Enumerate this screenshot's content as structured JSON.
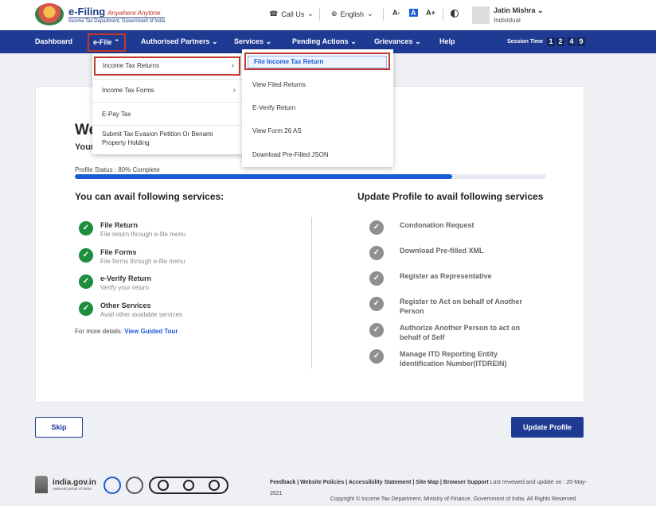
{
  "header": {
    "logo_title": "e-Filing",
    "logo_tagline": "Anywhere Anytime",
    "logo_subtitle": "Income Tax Department, Government of India",
    "call_us": "Call Us",
    "language": "English",
    "font_small": "A-",
    "font_normal": "A",
    "font_large": "A+",
    "user_name": "Jatin Mishra",
    "user_role": "Individual"
  },
  "nav": {
    "items": [
      "Dashboard",
      "e-File",
      "Authorised Partners",
      "Services",
      "Pending Actions",
      "Grievances",
      "Help"
    ],
    "session_label": "Session Time",
    "session_digits": [
      "1",
      "2",
      "4",
      "9"
    ]
  },
  "efile_menu": {
    "items": [
      "Income Tax Returns",
      "Income Tax Forms",
      "E-Pay Tax",
      "Submit Tax Evasion Petition Or Benami Property Holding"
    ]
  },
  "itr_submenu": {
    "items": [
      "File Income Tax Return",
      "View Filed Returns",
      "E-Verify Return",
      "View Form 26 AS",
      "Download Pre-Filled JSON"
    ]
  },
  "main": {
    "welcome": "We",
    "your": "Your",
    "profile_status": "Profile Status : 80% Complete",
    "profile_progress": 0.8,
    "avail_heading": "You can avail following services:",
    "update_heading": "Update Profile to avail following services",
    "avail_services": [
      {
        "title": "File Return",
        "desc": "File return through e-file menu"
      },
      {
        "title": "File Forms",
        "desc": "File forms through e-file menu"
      },
      {
        "title": "e-Verify Return",
        "desc": "Verify your return"
      },
      {
        "title": "Other Services",
        "desc": "Avail other available services"
      }
    ],
    "update_services": [
      "Condonation Request",
      "Download Pre-filled XML",
      "Register as Representative",
      "Register to Act on behalf of Another Person",
      "Authorize Another Person to act on behalf of Self",
      "Manage ITD Reporting Entity Identification Number(ITDREIN)"
    ],
    "more_details": "For more details:",
    "guided_tour": "View Guided Tour",
    "check_mark": "✓"
  },
  "buttons": {
    "skip": "Skip",
    "update_profile": "Update Profile"
  },
  "footer": {
    "india_gov": "india.gov.in",
    "india_gov_sub": "national portal of india",
    "links": "Feedback | Website Policies | Accessibility Statement | Site Map | Browser Support",
    "last_reviewed": "Last reviewed and update on : 20-May-2021",
    "copyright": "Copyright © Income Tax Department, Ministry of Finance, Government of India. All Rights Reserved"
  },
  "colors": {
    "nav_bg": "#1f3a93",
    "accent": "#1a5ad8",
    "highlight_border": "#c0392b",
    "success": "#1e8e3e"
  }
}
